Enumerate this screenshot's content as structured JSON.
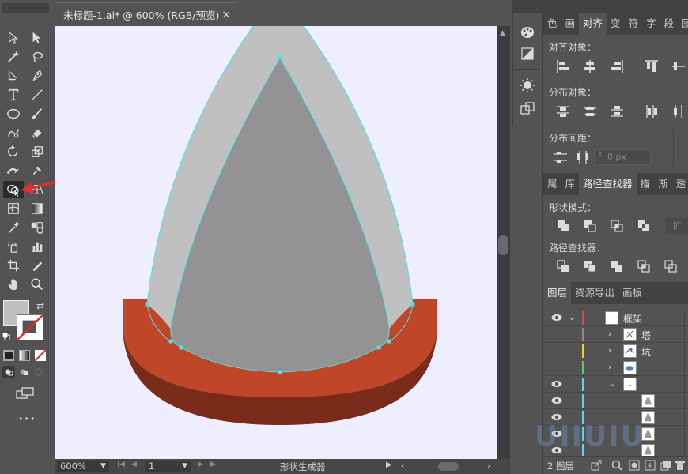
{
  "document": {
    "tab_title": "未标题-1.ai* @ 600% (RGB/预览)",
    "close_glyph": "×"
  },
  "toolbar": {
    "tools": [
      "selection-tool",
      "direct-selection-tool",
      "magic-wand-tool",
      "lasso-tool",
      "pen-tool",
      "curvature-tool",
      "type-tool",
      "line-tool",
      "ellipse-tool",
      "paintbrush-tool",
      "shaper-tool",
      "eraser-tool",
      "rotate-tool",
      "scale-tool",
      "width-tool",
      "puppet-warp-tool",
      "shape-builder-tool",
      "perspective-grid-tool",
      "mesh-tool",
      "gradient-tool",
      "eyedropper-tool",
      "blend-tool",
      "symbol-sprayer-tool",
      "column-graph-tool",
      "artboard-tool",
      "slice-tool",
      "hand-tool",
      "zoom-tool"
    ],
    "active_tool": "shape-builder-tool",
    "more_glyph": "•••",
    "annotation_color": "#e82a2a"
  },
  "status": {
    "zoom": "600%",
    "page": "1",
    "tool_name": "形状生成器"
  },
  "align_panel": {
    "tabs": [
      "色",
      "画",
      "对齐",
      "变",
      "符",
      "字",
      "段",
      "图"
    ],
    "active_tab": "对齐",
    "align_objects_label": "对齐对象：",
    "distribute_objects_label": "分布对象：",
    "distribute_spacing_label": "分布间距：",
    "spacing_value": "0 px"
  },
  "pathfinder_panel": {
    "tabs": [
      "属",
      "库",
      "路径查找器",
      "描",
      "渐",
      "透"
    ],
    "active_tab": "路径查找器",
    "shape_modes_label": "形状模式：",
    "pathfinders_label": "路径查找器：",
    "expand_label": "扩"
  },
  "layers_panel": {
    "tabs": [
      "图层",
      "资源导出",
      "画板"
    ],
    "active_tab": "图层",
    "rows": [
      {
        "name": "框架",
        "color": "#d14b4b",
        "level": 0,
        "expanded": true,
        "visible": true
      },
      {
        "name": "塔",
        "color": "#8a8a8a",
        "level": 1,
        "expanded": false,
        "visible": false
      },
      {
        "name": "坑",
        "color": "#e8d23a",
        "level": 1,
        "expanded": false,
        "visible": false
      },
      {
        "name": "",
        "color": "#5cc95c",
        "level": 1,
        "expanded": false,
        "visible": false
      },
      {
        "name": "",
        "color": "#5fd4e6",
        "level": 1,
        "expanded": true,
        "visible": true
      },
      {
        "name": "",
        "color": "#5fd4e6",
        "level": 2,
        "expanded": false,
        "visible": true
      },
      {
        "name": "",
        "color": "#5fd4e6",
        "level": 2,
        "expanded": false,
        "visible": true
      },
      {
        "name": "",
        "color": "#5fd4e6",
        "level": 2,
        "expanded": false,
        "visible": true
      },
      {
        "name": "",
        "color": "#5fd4e6",
        "level": 2,
        "expanded": false,
        "visible": true
      }
    ],
    "footer_count": "2 图层"
  },
  "artwork": {
    "outer_color": "#c0c0c0",
    "inner_color": "#939393",
    "base_top_color": "#c0462a",
    "base_side_color": "#7a2b1a",
    "path_color": "#4fe0e8",
    "canvas_bg": "#eeeefe"
  },
  "watermark_text": "UIIUIU"
}
